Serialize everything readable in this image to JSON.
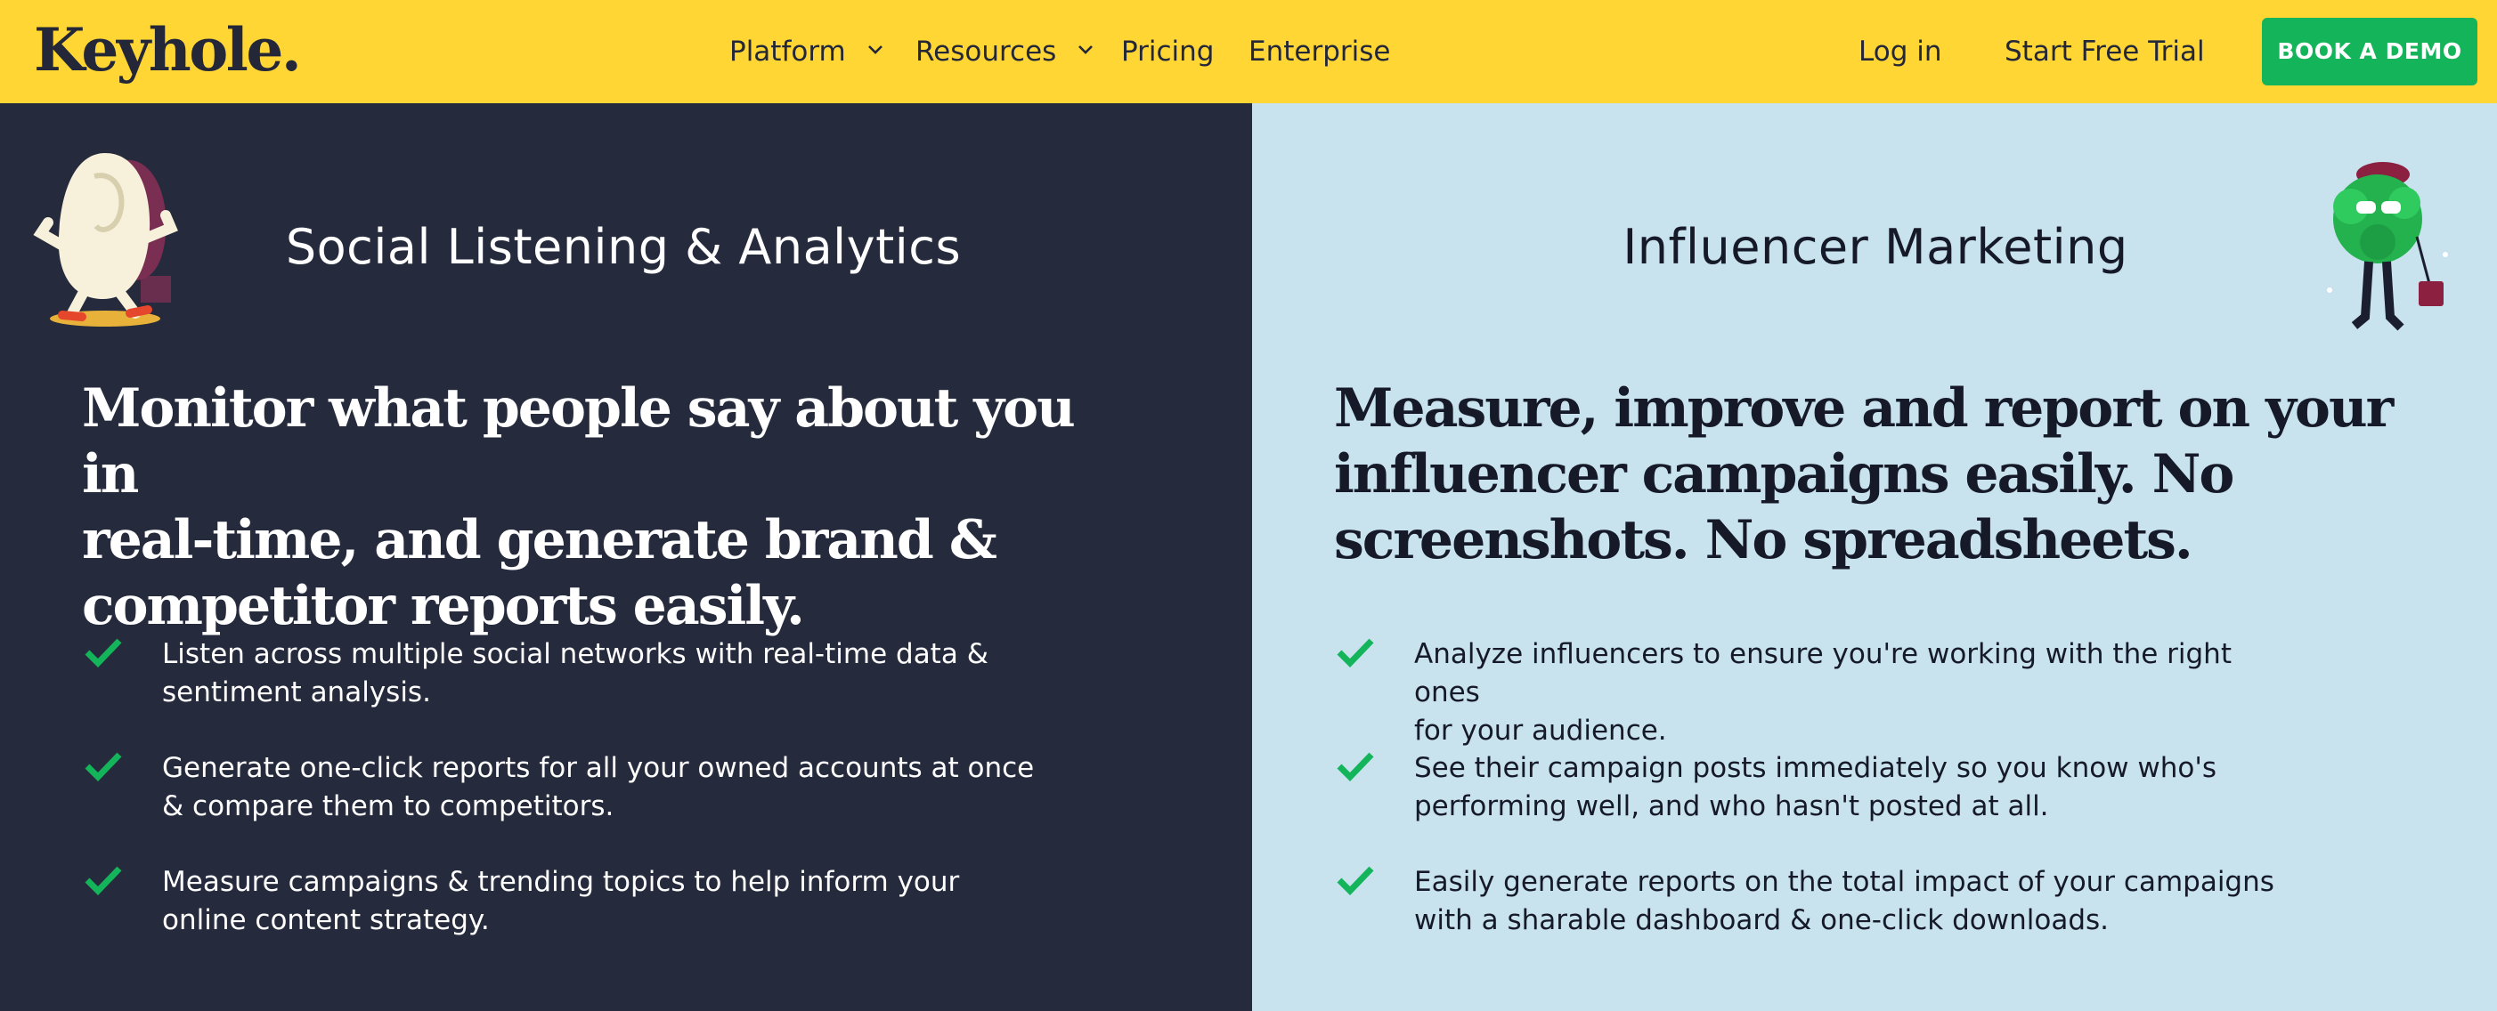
{
  "nav": {
    "logo": "Keyhole",
    "logo_dot": ".",
    "links": [
      {
        "label": "Platform",
        "dropdown": true
      },
      {
        "label": "Resources",
        "dropdown": true
      },
      {
        "label": "Pricing",
        "dropdown": false
      },
      {
        "label": "Enterprise",
        "dropdown": false
      }
    ],
    "login": "Log in",
    "trial": "Start Free Trial",
    "demo": "BOOK A DEMO"
  },
  "colors": {
    "nav_bg": "#FFD633",
    "dark_panel": "#252A3C",
    "light_panel": "#C8E2EE",
    "accent_green": "#14B45A",
    "text_dark": "#232738"
  },
  "left": {
    "title": "Social Listening & Analytics",
    "headline_lines": [
      "Monitor what people say about you in",
      "real-time, and generate brand &",
      "competitor reports easily."
    ],
    "features": [
      {
        "line1": "Listen across multiple social networks with real-time data &",
        "line2": "sentiment analysis."
      },
      {
        "line1": "Generate one-click reports for all your owned accounts at once",
        "line2": "& compare them to competitors."
      },
      {
        "line1": "Measure campaigns & trending topics to help inform your",
        "line2": "online content strategy."
      }
    ]
  },
  "right": {
    "title": "Influencer Marketing",
    "headline_lines": [
      "Measure, improve and report on your",
      "influencer campaigns easily. No",
      "screenshots. No spreadsheets."
    ],
    "features": [
      {
        "line1": "Analyze influencers to ensure you're working with the right ones",
        "line2": "for your audience."
      },
      {
        "line1": "See their campaign posts immediately so you know who's",
        "line2": "performing well, and who hasn't posted at all."
      },
      {
        "line1": "Easily generate reports on the total impact of your campaigns",
        "line2": "with a sharable dashboard & one-click downloads."
      }
    ]
  },
  "icons": {
    "check": "check-icon",
    "chevron": "chevron-down-icon",
    "mascot_left": "egg-mascot-illustration",
    "mascot_right": "bush-mascot-illustration"
  }
}
